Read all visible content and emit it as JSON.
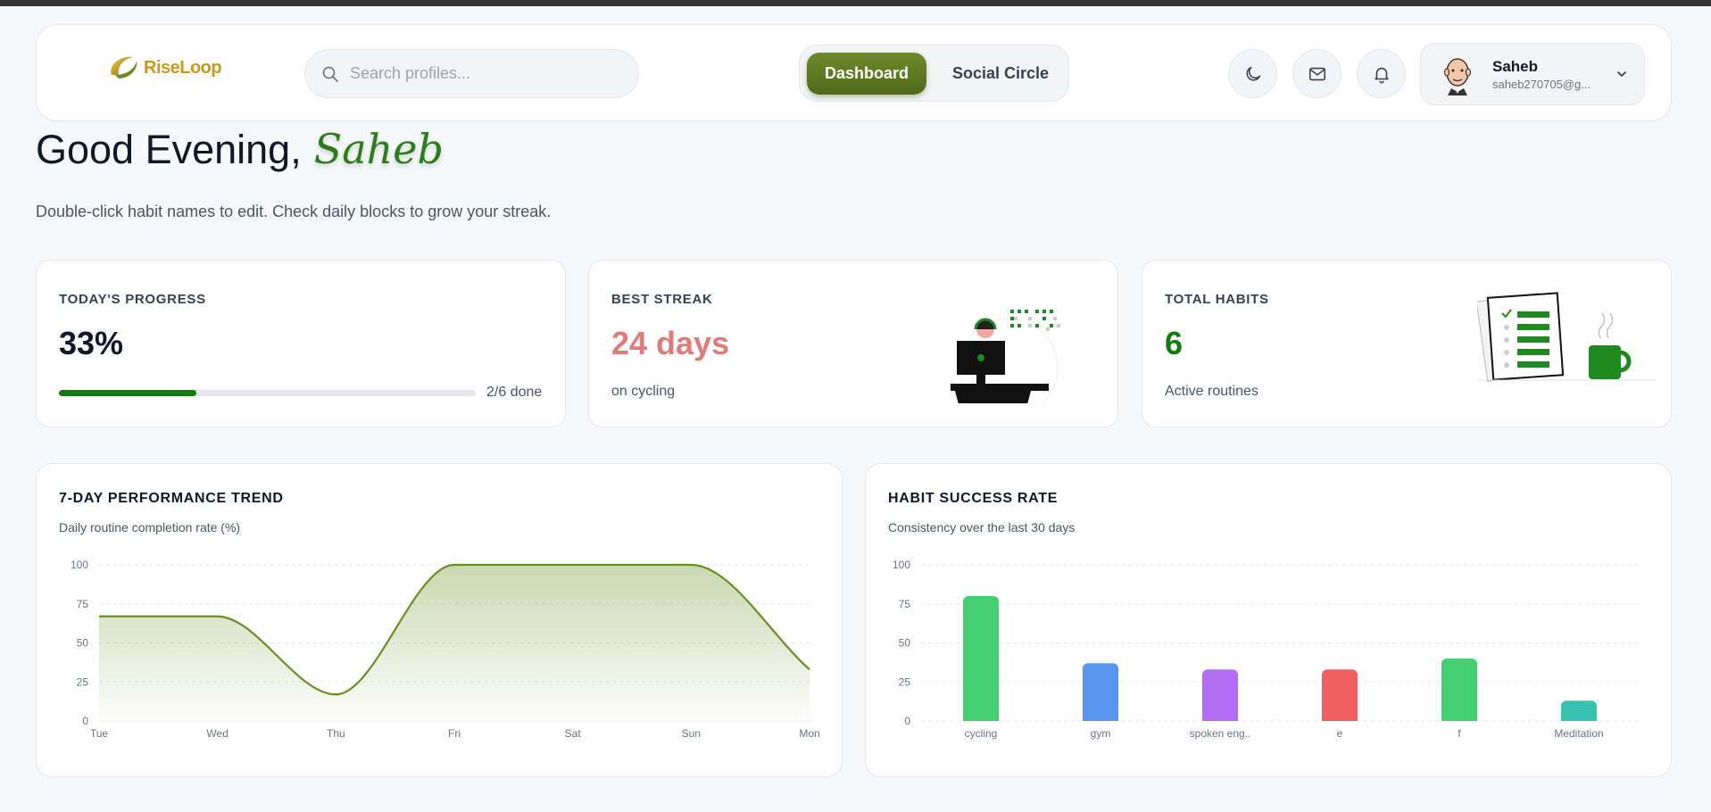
{
  "header": {
    "logo_text": "RiseLoop",
    "search": {
      "placeholder": "Search profiles..."
    },
    "nav": {
      "dashboard_label": "Dashboard",
      "social_label": "Social Circle",
      "active": "Dashboard"
    },
    "icons": [
      "moon-icon",
      "mail-icon",
      "bell-icon"
    ],
    "user": {
      "name": "Saheb",
      "email": "saheb270705@g..."
    }
  },
  "greeting": {
    "prefix": "Good Evening,",
    "name": "Saheb",
    "subtitle": "Double-click habit names to edit. Check daily blocks to grow your streak."
  },
  "stats": {
    "progress": {
      "label": "TODAY'S PROGRESS",
      "value": "33%",
      "fraction": 0.33,
      "done_text": "2/6 done",
      "color": "#177a10"
    },
    "streak": {
      "label": "BEST STREAK",
      "value": "24 days",
      "sub": "on cycling",
      "color": "#e07b7b"
    },
    "habits": {
      "label": "TOTAL HABITS",
      "value": "6",
      "sub": "Active routines",
      "color": "#177a10"
    }
  },
  "colors": {
    "accent": "#5a7a1f",
    "trend_line": "#6b8e23"
  },
  "chart_data": [
    {
      "type": "area",
      "title": "7-DAY PERFORMANCE TREND",
      "subtitle": "Daily routine completion rate (%)",
      "x": [
        "Tue",
        "Wed",
        "Thu",
        "Fri",
        "Sat",
        "Sun",
        "Mon"
      ],
      "values": [
        67,
        67,
        17,
        100,
        100,
        100,
        33
      ],
      "ylim": [
        0,
        100
      ],
      "yticks": [
        0,
        25,
        50,
        75,
        100
      ],
      "grid": true,
      "smooth": true
    },
    {
      "type": "bar",
      "title": "HABIT SUCCESS RATE",
      "subtitle": "Consistency over the last 30 days",
      "categories": [
        "cycling",
        "gym",
        "spoken eng..",
        "e",
        "f",
        "Meditation"
      ],
      "values": [
        80,
        37,
        33,
        33,
        40,
        13
      ],
      "colors": [
        "#43cf72",
        "#5b95f2",
        "#b26ef5",
        "#f06060",
        "#43cf72",
        "#38c2b2"
      ],
      "ylim": [
        0,
        100
      ],
      "yticks": [
        0,
        25,
        50,
        75,
        100
      ],
      "grid": true
    }
  ]
}
